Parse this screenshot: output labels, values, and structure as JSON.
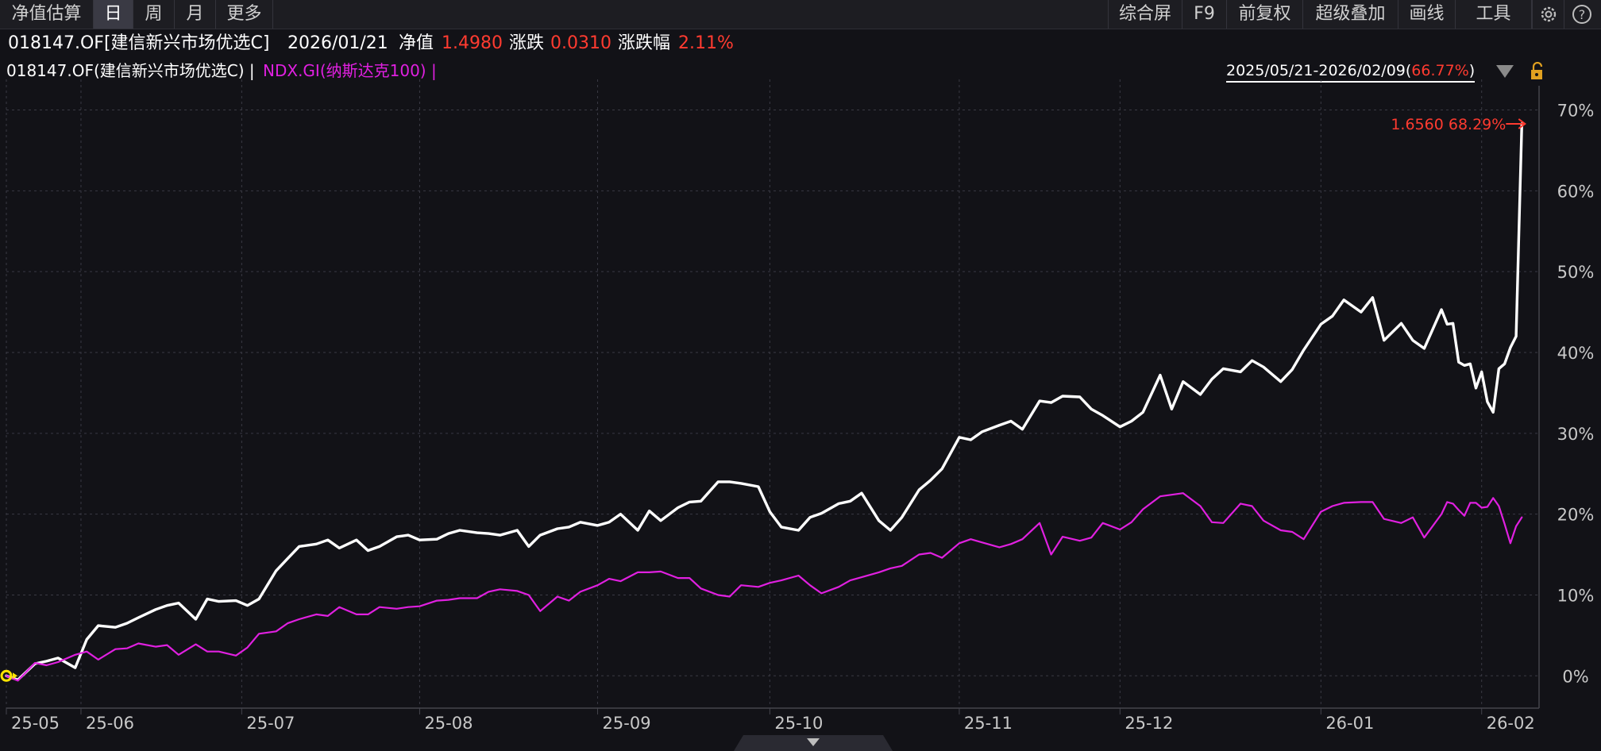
{
  "toolbar": {
    "left": [
      {
        "label": "净值估算",
        "active": false
      },
      {
        "label": "日",
        "active": true
      },
      {
        "label": "周",
        "active": false
      },
      {
        "label": "月",
        "active": false
      },
      {
        "label": "更多",
        "active": false
      }
    ],
    "right": [
      {
        "label": "综合屏"
      },
      {
        "label": "F9"
      },
      {
        "label": "前复权"
      },
      {
        "label": "超级叠加"
      },
      {
        "label": "画线"
      },
      {
        "label": "工具"
      }
    ],
    "icons": [
      "gear-icon",
      "help-icon"
    ]
  },
  "info": {
    "security": "018147.OF[建信新兴市场优选C]",
    "date": "2026/01/21",
    "nav_label": "净值",
    "nav_value": "1.4980",
    "change_label": "涨跌",
    "change_value": "0.0310",
    "pct_label": "涨跌幅",
    "pct_value": "2.11%"
  },
  "legend": {
    "series1": "018147.OF(建信新兴市场优选C) |",
    "series2": "NDX.GI(纳斯达克100) |"
  },
  "range": {
    "text": "2025/05/21-2026/02/09(",
    "pct": "66.77%",
    "close": ")"
  },
  "colors": {
    "background": "#121217",
    "fund_line": "#ffffff",
    "index_line": "#e020e0",
    "up": "#ff3b30",
    "grid": "#3a3a44"
  },
  "chart_data": {
    "type": "line",
    "ylim": [
      -4,
      73
    ],
    "yticks": [
      "70%",
      "60%",
      "50%",
      "40%",
      "30%",
      "20%",
      "10%",
      "0%"
    ],
    "ytick_values": [
      70,
      60,
      50,
      40,
      30,
      20,
      10,
      0
    ],
    "xlim": [
      "2025-05-21",
      "2026-02-12"
    ],
    "xticks": [
      {
        "label": "25-05",
        "date": "2025-05-21"
      },
      {
        "label": "25-06",
        "date": "2025-06-03"
      },
      {
        "label": "25-07",
        "date": "2025-07-01"
      },
      {
        "label": "25-08",
        "date": "2025-08-01"
      },
      {
        "label": "25-09",
        "date": "2025-09-01"
      },
      {
        "label": "25-10",
        "date": "2025-10-01"
      },
      {
        "label": "25-11",
        "date": "2025-11-03"
      },
      {
        "label": "25-12",
        "date": "2025-12-01"
      },
      {
        "label": "26-01",
        "date": "2026-01-05"
      },
      {
        "label": "26-02",
        "date": "2026-02-02"
      }
    ],
    "last_label": "1.6560 68.29%",
    "series": [
      {
        "name": "018147.OF(建信新兴市场优选C)",
        "color": "#ffffff",
        "points": [
          [
            "2025-05-21",
            0
          ],
          [
            "2025-05-23",
            -0.5
          ],
          [
            "2025-05-26",
            1.5
          ],
          [
            "2025-05-28",
            1.8
          ],
          [
            "2025-05-30",
            2.2
          ],
          [
            "2025-06-02",
            1
          ],
          [
            "2025-06-04",
            4.5
          ],
          [
            "2025-06-06",
            6.2
          ],
          [
            "2025-06-09",
            6
          ],
          [
            "2025-06-11",
            6.5
          ],
          [
            "2025-06-13",
            7.2
          ],
          [
            "2025-06-16",
            8.2
          ],
          [
            "2025-06-18",
            8.7
          ],
          [
            "2025-06-20",
            9
          ],
          [
            "2025-06-23",
            7
          ],
          [
            "2025-06-25",
            9.5
          ],
          [
            "2025-06-27",
            9.2
          ],
          [
            "2025-06-30",
            9.3
          ],
          [
            "2025-07-02",
            8.7
          ],
          [
            "2025-07-04",
            9.5
          ],
          [
            "2025-07-07",
            13
          ],
          [
            "2025-07-09",
            14.5
          ],
          [
            "2025-07-11",
            16
          ],
          [
            "2025-07-14",
            16.3
          ],
          [
            "2025-07-16",
            16.8
          ],
          [
            "2025-07-18",
            15.8
          ],
          [
            "2025-07-21",
            16.8
          ],
          [
            "2025-07-23",
            15.5
          ],
          [
            "2025-07-25",
            16
          ],
          [
            "2025-07-28",
            17.2
          ],
          [
            "2025-07-30",
            17.4
          ],
          [
            "2025-08-01",
            16.8
          ],
          [
            "2025-08-04",
            16.9
          ],
          [
            "2025-08-06",
            17.6
          ],
          [
            "2025-08-08",
            18
          ],
          [
            "2025-08-11",
            17.7
          ],
          [
            "2025-08-13",
            17.6
          ],
          [
            "2025-08-15",
            17.4
          ],
          [
            "2025-08-18",
            18
          ],
          [
            "2025-08-20",
            16
          ],
          [
            "2025-08-22",
            17.4
          ],
          [
            "2025-08-25",
            18.2
          ],
          [
            "2025-08-27",
            18.4
          ],
          [
            "2025-08-29",
            19
          ],
          [
            "2025-09-01",
            18.6
          ],
          [
            "2025-09-03",
            19
          ],
          [
            "2025-09-05",
            20
          ],
          [
            "2025-09-08",
            18
          ],
          [
            "2025-09-10",
            20.4
          ],
          [
            "2025-09-12",
            19.2
          ],
          [
            "2025-09-15",
            20.8
          ],
          [
            "2025-09-17",
            21.5
          ],
          [
            "2025-09-19",
            21.6
          ],
          [
            "2025-09-22",
            24
          ],
          [
            "2025-09-24",
            24
          ],
          [
            "2025-09-26",
            23.8
          ],
          [
            "2025-09-29",
            23.4
          ],
          [
            "2025-10-01",
            20.3
          ],
          [
            "2025-10-03",
            18.4
          ],
          [
            "2025-10-06",
            18
          ],
          [
            "2025-10-08",
            19.6
          ],
          [
            "2025-10-10",
            20.1
          ],
          [
            "2025-10-13",
            21.3
          ],
          [
            "2025-10-15",
            21.6
          ],
          [
            "2025-10-17",
            22.6
          ],
          [
            "2025-10-20",
            19.2
          ],
          [
            "2025-10-22",
            18
          ],
          [
            "2025-10-24",
            19.6
          ],
          [
            "2025-10-27",
            23
          ],
          [
            "2025-10-29",
            24.2
          ],
          [
            "2025-10-31",
            25.6
          ],
          [
            "2025-11-03",
            29.5
          ],
          [
            "2025-11-05",
            29.2
          ],
          [
            "2025-11-07",
            30.2
          ],
          [
            "2025-11-10",
            31
          ],
          [
            "2025-11-12",
            31.5
          ],
          [
            "2025-11-14",
            30.5
          ],
          [
            "2025-11-17",
            34
          ],
          [
            "2025-11-19",
            33.8
          ],
          [
            "2025-11-21",
            34.6
          ],
          [
            "2025-11-24",
            34.5
          ],
          [
            "2025-11-26",
            33
          ],
          [
            "2025-11-28",
            32.2
          ],
          [
            "2025-12-01",
            30.8
          ],
          [
            "2025-12-03",
            31.5
          ],
          [
            "2025-12-05",
            32.6
          ],
          [
            "2025-12-08",
            37.2
          ],
          [
            "2025-12-10",
            33
          ],
          [
            "2025-12-12",
            36.4
          ],
          [
            "2025-12-15",
            34.8
          ],
          [
            "2025-12-17",
            36.7
          ],
          [
            "2025-12-19",
            38
          ],
          [
            "2025-12-22",
            37.6
          ],
          [
            "2025-12-24",
            39
          ],
          [
            "2025-12-26",
            38.2
          ],
          [
            "2025-12-29",
            36.4
          ],
          [
            "2025-12-31",
            37.9
          ],
          [
            "2026-01-02",
            40.3
          ],
          [
            "2026-01-05",
            43.5
          ],
          [
            "2026-01-07",
            44.5
          ],
          [
            "2026-01-09",
            46.5
          ],
          [
            "2026-01-12",
            45
          ],
          [
            "2026-01-14",
            46.8
          ],
          [
            "2026-01-16",
            41.5
          ],
          [
            "2026-01-19",
            43.6
          ],
          [
            "2026-01-21",
            41.5
          ],
          [
            "2026-01-23",
            40.5
          ],
          [
            "2026-01-26",
            45.3
          ],
          [
            "2026-01-27",
            43.5
          ],
          [
            "2026-01-28",
            43.6
          ],
          [
            "2026-01-29",
            38.8
          ],
          [
            "2026-01-30",
            38.4
          ],
          [
            "2026-01-31",
            38.6
          ],
          [
            "2026-02-01",
            35.6
          ],
          [
            "2026-02-02",
            37.6
          ],
          [
            "2026-02-03",
            33.9
          ],
          [
            "2026-02-04",
            32.6
          ],
          [
            "2026-02-05",
            38
          ],
          [
            "2026-02-06",
            38.6
          ],
          [
            "2026-02-07",
            40.6
          ],
          [
            "2026-02-08",
            42
          ],
          [
            "2026-02-09",
            68.29
          ]
        ]
      },
      {
        "name": "NDX.GI(纳斯达克100)",
        "color": "#e020e0",
        "points": [
          [
            "2025-05-21",
            0
          ],
          [
            "2025-05-23",
            -0.6
          ],
          [
            "2025-05-26",
            1.6
          ],
          [
            "2025-05-28",
            1.3
          ],
          [
            "2025-05-30",
            1.7
          ],
          [
            "2025-06-02",
            2.6
          ],
          [
            "2025-06-04",
            3
          ],
          [
            "2025-06-06",
            2
          ],
          [
            "2025-06-09",
            3.3
          ],
          [
            "2025-06-11",
            3.4
          ],
          [
            "2025-06-13",
            4
          ],
          [
            "2025-06-16",
            3.6
          ],
          [
            "2025-06-18",
            3.8
          ],
          [
            "2025-06-20",
            2.6
          ],
          [
            "2025-06-23",
            3.9
          ],
          [
            "2025-06-25",
            3
          ],
          [
            "2025-06-27",
            3
          ],
          [
            "2025-06-30",
            2.5
          ],
          [
            "2025-07-02",
            3.5
          ],
          [
            "2025-07-04",
            5.2
          ],
          [
            "2025-07-07",
            5.5
          ],
          [
            "2025-07-09",
            6.5
          ],
          [
            "2025-07-11",
            7
          ],
          [
            "2025-07-14",
            7.6
          ],
          [
            "2025-07-16",
            7.4
          ],
          [
            "2025-07-18",
            8.5
          ],
          [
            "2025-07-21",
            7.6
          ],
          [
            "2025-07-23",
            7.6
          ],
          [
            "2025-07-25",
            8.5
          ],
          [
            "2025-07-28",
            8.3
          ],
          [
            "2025-07-30",
            8.5
          ],
          [
            "2025-08-01",
            8.6
          ],
          [
            "2025-08-04",
            9.3
          ],
          [
            "2025-08-06",
            9.4
          ],
          [
            "2025-08-08",
            9.6
          ],
          [
            "2025-08-11",
            9.6
          ],
          [
            "2025-08-13",
            10.4
          ],
          [
            "2025-08-15",
            10.7
          ],
          [
            "2025-08-18",
            10.5
          ],
          [
            "2025-08-20",
            10
          ],
          [
            "2025-08-22",
            8
          ],
          [
            "2025-08-25",
            9.8
          ],
          [
            "2025-08-27",
            9.3
          ],
          [
            "2025-08-29",
            10.4
          ],
          [
            "2025-09-01",
            11.2
          ],
          [
            "2025-09-03",
            12
          ],
          [
            "2025-09-05",
            11.7
          ],
          [
            "2025-09-08",
            12.8
          ],
          [
            "2025-09-10",
            12.8
          ],
          [
            "2025-09-12",
            12.9
          ],
          [
            "2025-09-15",
            12.1
          ],
          [
            "2025-09-17",
            12.1
          ],
          [
            "2025-09-19",
            10.8
          ],
          [
            "2025-09-22",
            10
          ],
          [
            "2025-09-24",
            9.8
          ],
          [
            "2025-09-26",
            11.2
          ],
          [
            "2025-09-29",
            11
          ],
          [
            "2025-10-01",
            11.5
          ],
          [
            "2025-10-03",
            11.8
          ],
          [
            "2025-10-06",
            12.4
          ],
          [
            "2025-10-08",
            11.2
          ],
          [
            "2025-10-10",
            10.2
          ],
          [
            "2025-10-13",
            11
          ],
          [
            "2025-10-15",
            11.8
          ],
          [
            "2025-10-17",
            12.2
          ],
          [
            "2025-10-20",
            12.8
          ],
          [
            "2025-10-22",
            13.3
          ],
          [
            "2025-10-24",
            13.6
          ],
          [
            "2025-10-27",
            15
          ],
          [
            "2025-10-29",
            15.2
          ],
          [
            "2025-10-31",
            14.6
          ],
          [
            "2025-11-03",
            16.4
          ],
          [
            "2025-11-05",
            16.9
          ],
          [
            "2025-11-07",
            16.5
          ],
          [
            "2025-11-10",
            15.9
          ],
          [
            "2025-11-12",
            16.3
          ],
          [
            "2025-11-14",
            16.9
          ],
          [
            "2025-11-17",
            18.9
          ],
          [
            "2025-11-19",
            15
          ],
          [
            "2025-11-21",
            17.2
          ],
          [
            "2025-11-24",
            16.7
          ],
          [
            "2025-11-26",
            17.1
          ],
          [
            "2025-11-28",
            18.9
          ],
          [
            "2025-12-01",
            18.1
          ],
          [
            "2025-12-03",
            19
          ],
          [
            "2025-12-05",
            20.6
          ],
          [
            "2025-12-08",
            22.2
          ],
          [
            "2025-12-10",
            22.4
          ],
          [
            "2025-12-12",
            22.6
          ],
          [
            "2025-12-15",
            21
          ],
          [
            "2025-12-17",
            19
          ],
          [
            "2025-12-19",
            18.9
          ],
          [
            "2025-12-22",
            21.3
          ],
          [
            "2025-12-24",
            21
          ],
          [
            "2025-12-26",
            19.2
          ],
          [
            "2025-12-29",
            18
          ],
          [
            "2025-12-31",
            17.8
          ],
          [
            "2026-01-02",
            16.9
          ],
          [
            "2026-01-05",
            20.3
          ],
          [
            "2026-01-07",
            21
          ],
          [
            "2026-01-09",
            21.4
          ],
          [
            "2026-01-12",
            21.5
          ],
          [
            "2026-01-14",
            21.5
          ],
          [
            "2026-01-16",
            19.4
          ],
          [
            "2026-01-19",
            18.9
          ],
          [
            "2026-01-21",
            19.6
          ],
          [
            "2026-01-23",
            17.1
          ],
          [
            "2026-01-26",
            20
          ],
          [
            "2026-01-27",
            21.5
          ],
          [
            "2026-01-28",
            21.3
          ],
          [
            "2026-01-29",
            20.5
          ],
          [
            "2026-01-30",
            19.8
          ],
          [
            "2026-01-31",
            21.4
          ],
          [
            "2026-02-01",
            21.4
          ],
          [
            "2026-02-02",
            20.8
          ],
          [
            "2026-02-03",
            20.9
          ],
          [
            "2026-02-04",
            22
          ],
          [
            "2026-02-05",
            21
          ],
          [
            "2026-02-06",
            18.8
          ],
          [
            "2026-02-07",
            16.4
          ],
          [
            "2026-02-08",
            18.5
          ],
          [
            "2026-02-09",
            19.6
          ]
        ]
      }
    ]
  }
}
